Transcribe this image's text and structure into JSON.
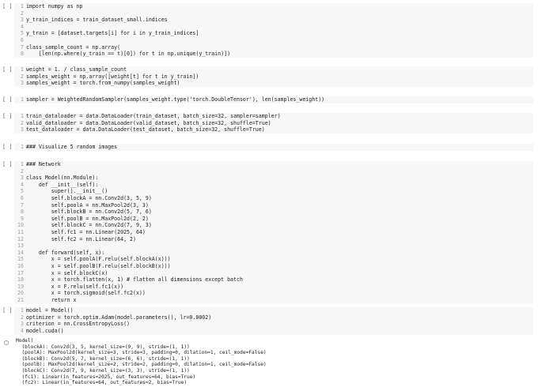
{
  "cells": [
    {
      "run_label": "[ ]",
      "lines": [
        "import numpy as np",
        "",
        "y_train_indices = train_dataset_small.indices",
        "",
        "y_train = [dataset.targets[i] for i in y_train_indices]",
        "",
        "class_sample_count = np.array(",
        "    [len(np.where(y_train == t)[0]) for t in np.unique(y_train)])"
      ]
    },
    {
      "run_label": "[ ]",
      "lines": [
        "weight = 1. / class_sample_count",
        "samples_weight = np.array([weight[t] for t in y_train])",
        "samples_weight = torch.from_numpy(samples_weight)"
      ]
    },
    {
      "run_label": "[ ]",
      "lines": [
        "sampler = WeightedRandomSampler(samples_weight.type('torch.DoubleTensor'), len(samples_weight))"
      ]
    },
    {
      "run_label": "[ ]",
      "lines": [
        "train_dataloader = data.DataLoader(train_dataset, batch_size=32, sampler=sampler)",
        "valid_dataloader = data.DataLoader(valid_dataset, batch_size=32, shuffle=True)",
        "test_dataloader = data.DataLoader(test_dataset, batch_size=32, shuffle=True)"
      ]
    },
    {
      "run_label": "[ ]",
      "lines": [
        "### Visualize 5 random images"
      ]
    },
    {
      "run_label": "[ ]",
      "lines": [
        "### Network",
        "",
        "class Model(nn.Module):",
        "    def __init__(self):",
        "        super().__init__()",
        "        self.blockA = nn.Conv2d(3, 5, 9)",
        "        self.poolA = nn.MaxPool2d(3, 3)",
        "        self.blockB = nn.Conv2d(5, 7, 6)",
        "        self.poolB = nn.MaxPool2d(2, 2)",
        "        self.blockC = nn.Conv2d(7, 9, 3)",
        "        self.fc1 = nn.Linear(2025, 64)",
        "        self.fc2 = nn.Linear(64, 2)",
        "",
        "    def forward(self, x):",
        "        x = self.poolA(F.relu(self.blockA(x)))",
        "        x = self.poolB(F.relu(self.blockB(x)))",
        "        x = self.blockC(x)",
        "        x = torch.flatten(x, 1) # flatten all dimensions except batch",
        "        x = F.relu(self.fc1(x))",
        "        x = torch.sigmoid(self.fc2(x))",
        "        return x"
      ]
    },
    {
      "run_label": "[ ]",
      "lines": [
        "model = Model()",
        "optimizer = torch.optim.Adam(model.parameters(), lr=0.0002)",
        "criterion = nn.CrossEntropyLoss()",
        "model.cuda()"
      ]
    }
  ],
  "output": [
    "Model(",
    "  (blockA): Conv2d(3, 5, kernel_size=(9, 9), stride=(1, 1))",
    "  (poolA): MaxPool2d(kernel_size=3, stride=3, padding=0, dilation=1, ceil_mode=False)",
    "  (blockB): Conv2d(5, 7, kernel_size=(6, 6), stride=(1, 1))",
    "  (poolB): MaxPool2d(kernel_size=2, stride=2, padding=0, dilation=1, ceil_mode=False)",
    "  (blockC): Conv2d(7, 9, kernel_size=(3, 3), stride=(1, 1))",
    "  (fc1): Linear(in_features=2025, out_features=64, bias=True)",
    "  (fc2): Linear(in_features=64, out_features=2, bias=True)"
  ]
}
